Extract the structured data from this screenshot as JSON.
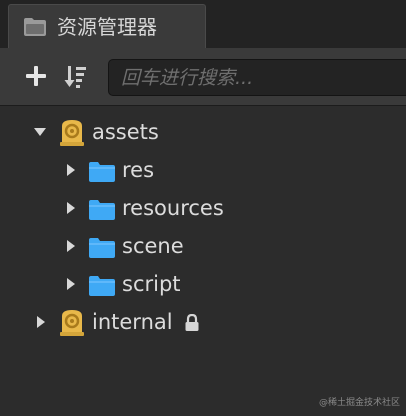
{
  "window": {
    "tab_title": "资源管理器",
    "tab_icon": "folder-icon"
  },
  "toolbar": {
    "add_icon": "plus-icon",
    "sort_icon": "sort-icon",
    "search_placeholder": "回车进行搜索...",
    "search_value": ""
  },
  "tree": {
    "items": [
      {
        "label": "assets",
        "icon": "database-icon",
        "expanded": true,
        "level": 0,
        "locked": false
      },
      {
        "label": "res",
        "icon": "folder-icon",
        "expanded": false,
        "level": 1,
        "locked": false
      },
      {
        "label": "resources",
        "icon": "folder-icon",
        "expanded": false,
        "level": 1,
        "locked": false
      },
      {
        "label": "scene",
        "icon": "folder-icon",
        "expanded": false,
        "level": 1,
        "locked": false
      },
      {
        "label": "script",
        "icon": "folder-icon",
        "expanded": false,
        "level": 1,
        "locked": false
      },
      {
        "label": "internal",
        "icon": "database-icon",
        "expanded": false,
        "level": 0,
        "locked": true
      }
    ]
  },
  "watermark": "@稀土掘金技术社区",
  "colors": {
    "folder": "#3fa9f5",
    "database": "#e8b84a",
    "text": "#dcdcdc",
    "panel_bg": "#2c2c2c",
    "toolbar_bg": "#3a3a3a"
  }
}
